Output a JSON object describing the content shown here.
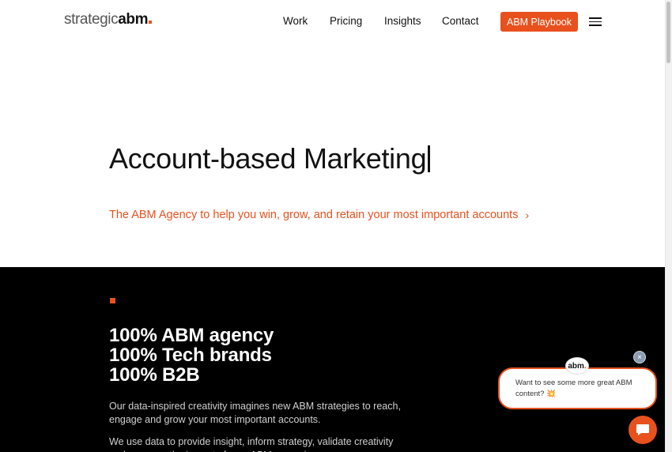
{
  "header": {
    "logo_part1": "strategic",
    "logo_part2": "abm",
    "nav": [
      "Work",
      "Pricing",
      "Insights",
      "Contact"
    ],
    "cta_label": "ABM Playbook",
    "menu_icon": "hamburger-icon"
  },
  "hero": {
    "title": "Account-based Marketing",
    "subtitle_link": "The ABM Agency to help you win, grow, and retain your most important accounts",
    "chevron": "›"
  },
  "dark_section": {
    "headlines": [
      "100% ABM agency",
      "100% Tech brands",
      "100% B2B"
    ],
    "para1": "Our data-inspired creativity imagines new ABM strategies to reach, engage and grow your most important accounts.",
    "para2": "We use data to provide insight, inform strategy, validate creativity and measure the impact of your ABM campaigns."
  },
  "chat": {
    "close_symbol": "×",
    "avatar_text": "abm",
    "message": "Want to see some more great ABM content? 💥"
  },
  "colors": {
    "accent": "#e8511e",
    "dark_bg": "#000000"
  }
}
